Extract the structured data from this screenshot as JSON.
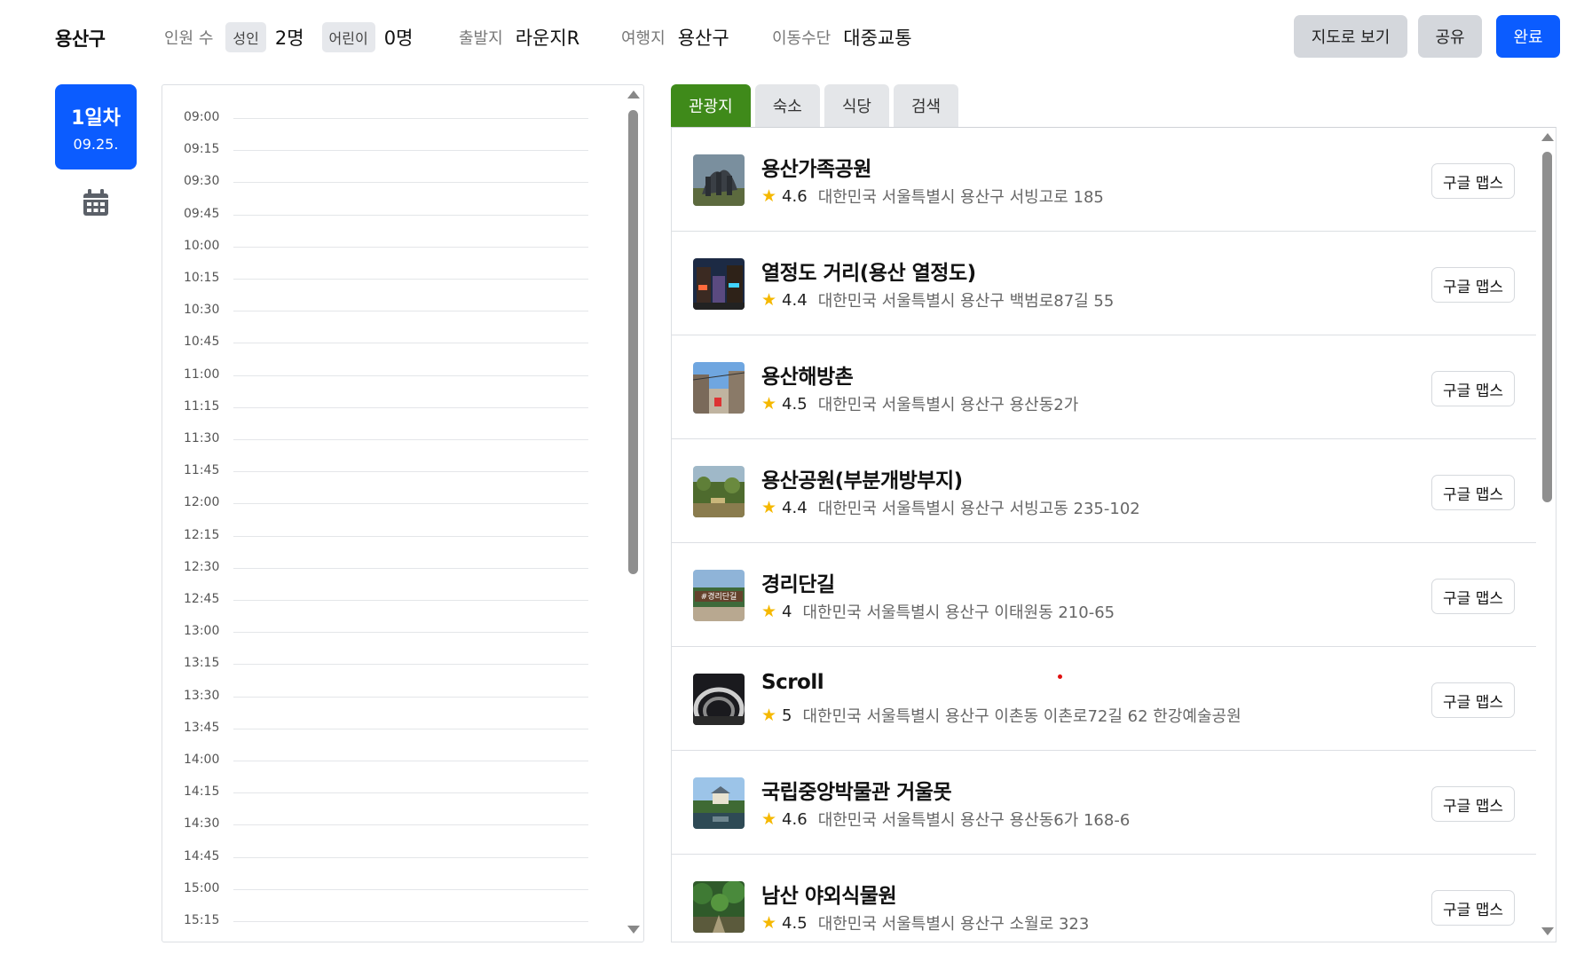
{
  "header": {
    "region": "용산구",
    "people_label": "인원 수",
    "adult_chip": "성인",
    "adult_count": "2명",
    "child_chip": "어린이",
    "child_count": "0명",
    "origin_label": "출발지",
    "origin_value": "라운지R",
    "destination_label": "여행지",
    "destination_value": "용산구",
    "transport_label": "이동수단",
    "transport_value": "대중교통",
    "map_button": "지도로 보기",
    "share_button": "공유",
    "done_button": "완료"
  },
  "day": {
    "title": "1일차",
    "date": "09.25."
  },
  "timeline": {
    "times": [
      "09:00",
      "09:15",
      "09:30",
      "09:45",
      "10:00",
      "10:15",
      "10:30",
      "10:45",
      "11:00",
      "11:15",
      "11:30",
      "11:45",
      "12:00",
      "12:15",
      "12:30",
      "12:45",
      "13:00",
      "13:15",
      "13:30",
      "13:45",
      "14:00",
      "14:15",
      "14:30",
      "14:45",
      "15:00",
      "15:15"
    ]
  },
  "tabs": [
    "관광지",
    "숙소",
    "식당",
    "검색"
  ],
  "gmaps_label": "구글 맵스",
  "places": [
    {
      "name": "용산가족공원",
      "rating": "4.6",
      "address": "대한민국 서울특별시 용산구 서빙고로 185"
    },
    {
      "name": "열정도 거리(용산 열정도)",
      "rating": "4.4",
      "address": "대한민국 서울특별시 용산구 백범로87길 55"
    },
    {
      "name": "용산해방촌",
      "rating": "4.5",
      "address": "대한민국 서울특별시 용산구 용산동2가"
    },
    {
      "name": "용산공원(부분개방부지)",
      "rating": "4.4",
      "address": "대한민국 서울특별시 용산구 서빙고동 235-102"
    },
    {
      "name": "경리단길",
      "rating": "4",
      "address": "대한민국 서울특별시 용산구 이태원동 210-65"
    },
    {
      "name": "Scroll",
      "rating": "5",
      "address": "대한민국 서울특별시 용산구 이촌동 이촌로72길 62 한강예술공원"
    },
    {
      "name": "국립중앙박물관 거울못",
      "rating": "4.6",
      "address": "대한민국 서울특별시 용산구 용산동6가 168-6"
    },
    {
      "name": "남산 야외식물원",
      "rating": "4.5",
      "address": "대한민국 서울특별시 용산구 소월로 323"
    }
  ],
  "thumb_label_5": "#경리단길",
  "colors": {
    "accent": "#0b5cff",
    "active_tab": "#3f8a1a",
    "star": "#f5b800"
  }
}
